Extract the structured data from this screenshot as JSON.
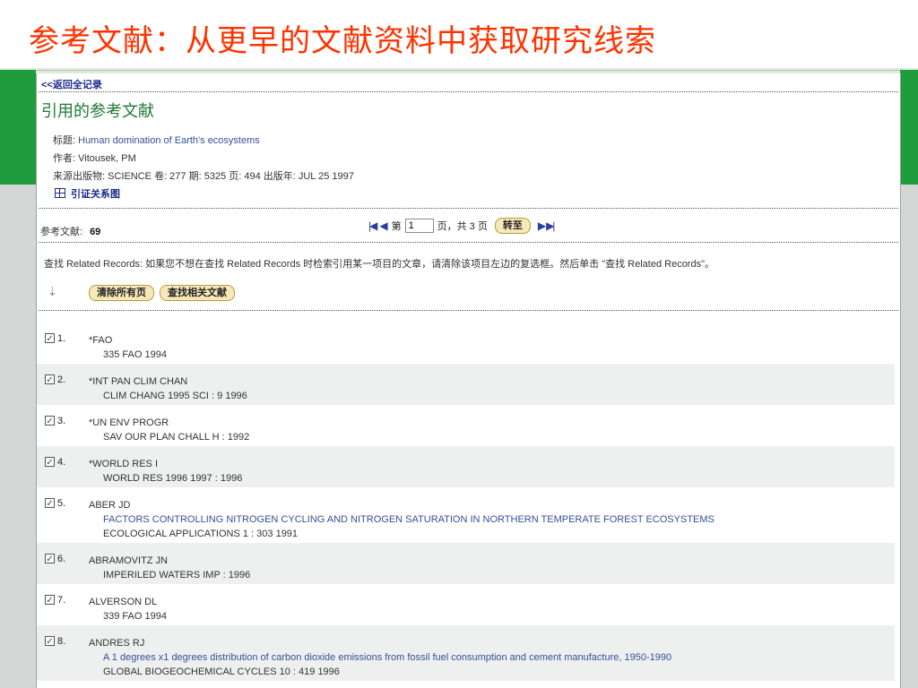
{
  "slide": {
    "title": "参考文献：从更早的文献资料中获取研究线索"
  },
  "nav": {
    "back": "<<返回全记录"
  },
  "section": {
    "heading": "引用的参考文献"
  },
  "meta": {
    "title_label": "标题: ",
    "title_value": "Human domination of Earth's ecosystems",
    "author_label": "作者: ",
    "author_value": "Vitousek, PM",
    "source_text": "来源出版物: SCIENCE 卷: 277 期: 5325 页: 494 出版年: JUL 25 1997",
    "citation_map": "引证关系图"
  },
  "refs": {
    "label": "参考文献:",
    "count": "69"
  },
  "pager": {
    "first_icon": "first-page-icon",
    "prev_icon": "prev-page-icon",
    "page_prefix": "第",
    "page_value": "1",
    "page_suffix": "页，共 3 页",
    "go": "转至",
    "next_icon": "next-page-icon",
    "last_icon": "last-page-icon"
  },
  "instructions": "查找 Related Records: 如果您不想在查找 Related Records 时检索引用某一项目的文章，请清除该项目左边的复选框。然后单击 \"查找 Related Records\"。",
  "actions": {
    "clear": "清除所有页",
    "find": "查找相关文献"
  },
  "records": [
    {
      "num": "1.",
      "checked": true,
      "author": "*FAO",
      "title": "",
      "source": "335 FAO 1994"
    },
    {
      "num": "2.",
      "checked": true,
      "author": "*INT PAN CLIM CHAN",
      "title": "",
      "source": "CLIM CHANG 1995 SCI : 9 1996"
    },
    {
      "num": "3.",
      "checked": true,
      "author": "*UN ENV PROGR",
      "title": "",
      "source": "SAV OUR PLAN CHALL H : 1992"
    },
    {
      "num": "4.",
      "checked": true,
      "author": "*WORLD RES I",
      "title": "",
      "source": "WORLD RES 1996 1997 : 1996"
    },
    {
      "num": "5.",
      "checked": true,
      "author": "ABER JD",
      "title": "FACTORS CONTROLLING NITROGEN CYCLING AND NITROGEN SATURATION IN NORTHERN TEMPERATE FOREST ECOSYSTEMS",
      "source": "ECOLOGICAL APPLICATIONS 1 : 303 1991"
    },
    {
      "num": "6.",
      "checked": true,
      "author": "ABRAMOVITZ JN",
      "title": "",
      "source": "IMPERILED WATERS IMP : 1996"
    },
    {
      "num": "7.",
      "checked": true,
      "author": "ALVERSON DL",
      "title": "",
      "source": "339 FAO 1994"
    },
    {
      "num": "8.",
      "checked": true,
      "author": "ANDRES RJ",
      "title": "A 1 degrees x1 degrees distribution of carbon dioxide emissions from fossil fuel consumption and cement manufacture, 1950-1990",
      "source": "GLOBAL BIOGEOCHEMICAL CYCLES 10 : 419 1996"
    }
  ]
}
